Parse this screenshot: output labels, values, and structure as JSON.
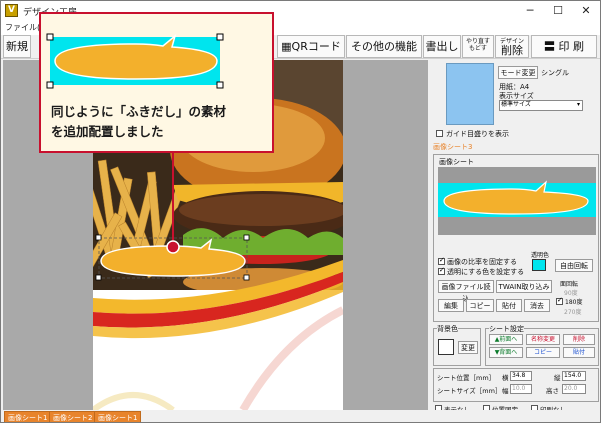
{
  "window": {
    "title": "デザイン工房",
    "minimize_glyph": "─",
    "maximize_glyph": "☐",
    "close_glyph": "✕"
  },
  "menu": {
    "file": "ファイル(F)"
  },
  "toolbar": {
    "new": "新規",
    "qr": "QRコード",
    "other": "その他の機能",
    "write": "書出し",
    "redo_top": "やり直す",
    "redo_bottom": "もどす",
    "delete_top": "デザイン",
    "delete_bottom": "削除",
    "print": "印 刷"
  },
  "callout": {
    "line1": "同じように「ふきだし」の素材",
    "line2": "を追加配置しました"
  },
  "panel": {
    "mode_button": "モード変更",
    "mode_value": "シングル",
    "paper": "用紙：A4",
    "display_size_label": "表示サイズ",
    "display_size_value": "標準サイズ",
    "guide_checkbox": "ガイド目盛りを表示",
    "sheet_header": "画像シート3",
    "image_sheet_label": "画像シート",
    "fix_ratio": "画像の比率を固定する",
    "transparent_color": "透明にする色を設定する",
    "transparent_label": "透明色",
    "free_rotate": "自由回転",
    "image_load": "画像ファイル読込",
    "twain": "TWAIN取り込み",
    "rotate_label": "面回転",
    "rotate_90": "90度",
    "rotate_180": "180度",
    "rotate_270": "270度",
    "edit": "編集",
    "copy": "コピー",
    "paste": "貼付",
    "erase": "消去",
    "bg_label": "背景色",
    "bg_change": "変更",
    "sheet_setting": "シート設定",
    "front": "▲前面へ",
    "back": "▼背面へ",
    "rename": "名称変更",
    "copy2": "コピー",
    "delete": "削除",
    "paste2": "貼付",
    "position_label": "シート位置［mm］",
    "x_label": "横",
    "x_value": "34.8",
    "y_label": "縦",
    "y_value": "154.0",
    "size_label": "シートサイズ［mm］",
    "w_label": "幅",
    "w_value": "10.0",
    "h_label": "高さ",
    "h_value": "20.0",
    "hide": "表示なし",
    "lock": "位置固定",
    "noprint": "印刷なし"
  },
  "tabs": [
    "画像シート1",
    "画像シート2",
    "画像シート1"
  ],
  "colors": {
    "accent_red": "#c8102e",
    "cyan": "#00e5ee",
    "bubble": "#f3b02c",
    "tab_orange": "#e8842c",
    "preview_blue": "#8cc4f0"
  }
}
